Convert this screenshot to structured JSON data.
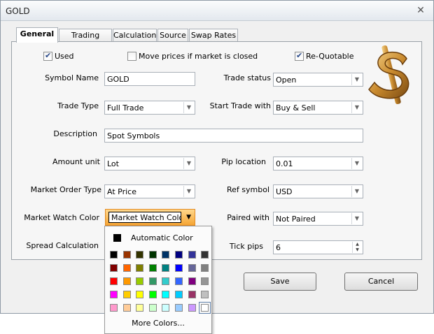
{
  "window": {
    "title": "GOLD",
    "close_glyph": "✕"
  },
  "tabs": [
    {
      "label": "General",
      "active": true
    },
    {
      "label": "Trading Times",
      "active": false
    },
    {
      "label": "Calculation",
      "active": false
    },
    {
      "label": "Source",
      "active": false
    },
    {
      "label": "Swap Rates",
      "active": false
    }
  ],
  "checkboxes": {
    "used": {
      "label": "Used",
      "checked": true
    },
    "move_prices": {
      "label": "Move prices if market is closed",
      "checked": false
    },
    "requotable": {
      "label": "Re-Quotable",
      "checked": true
    }
  },
  "fields": {
    "symbol_name": {
      "label": "Symbol Name",
      "value": "GOLD"
    },
    "trade_status": {
      "label": "Trade status",
      "value": "Open"
    },
    "trade_type": {
      "label": "Trade Type",
      "value": "Full Trade"
    },
    "start_trade_with": {
      "label": "Start Trade with",
      "value": "Buy & Sell"
    },
    "description": {
      "label": "Description",
      "value": "Spot Symbols"
    },
    "amount_unit": {
      "label": "Amount unit",
      "value": "Lot"
    },
    "pip_location": {
      "label": "Pip location",
      "value": "0.01"
    },
    "market_order_type": {
      "label": "Market Order Type",
      "value": "At Price"
    },
    "ref_symbol": {
      "label": "Ref symbol",
      "value": "USD"
    },
    "market_watch_color": {
      "label": "Market Watch Color",
      "value": "Market Watch Color"
    },
    "paired_with": {
      "label": "Paired with",
      "value": "Not Paired"
    },
    "spread_calculation": {
      "label": "Spread Calculation"
    },
    "tick_pips": {
      "label": "Tick pips",
      "value": "6"
    }
  },
  "buttons": {
    "save": "Save",
    "cancel": "Cancel"
  },
  "color_popup": {
    "automatic_label": "Automatic Color",
    "automatic_color": "#000000",
    "more_label": "More Colors...",
    "rows": [
      [
        "#000000",
        "#993300",
        "#333300",
        "#003300",
        "#003366",
        "#000080",
        "#333399",
        "#333333"
      ],
      [
        "#800000",
        "#ff6600",
        "#808000",
        "#008000",
        "#008080",
        "#0000ff",
        "#666699",
        "#808080"
      ],
      [
        "#ff0000",
        "#ff9900",
        "#99cc00",
        "#339966",
        "#33cccc",
        "#3366ff",
        "#800080",
        "#969696"
      ],
      [
        "#ff00ff",
        "#ffcc00",
        "#ffff00",
        "#00ff00",
        "#00ffff",
        "#00ccff",
        "#993366",
        "#c0c0c0"
      ],
      [
        "#ff99cc",
        "#ffcc99",
        "#ffff99",
        "#ccffcc",
        "#ccffff",
        "#99ccff",
        "#cc99ff",
        "#ffffff"
      ]
    ],
    "selected": [
      4,
      7
    ]
  },
  "icons": {
    "logo": "gold-dollar-sign-icon"
  },
  "colors": {
    "accent_orange": "#f5a534",
    "logo_gold": "#c98a2e"
  }
}
